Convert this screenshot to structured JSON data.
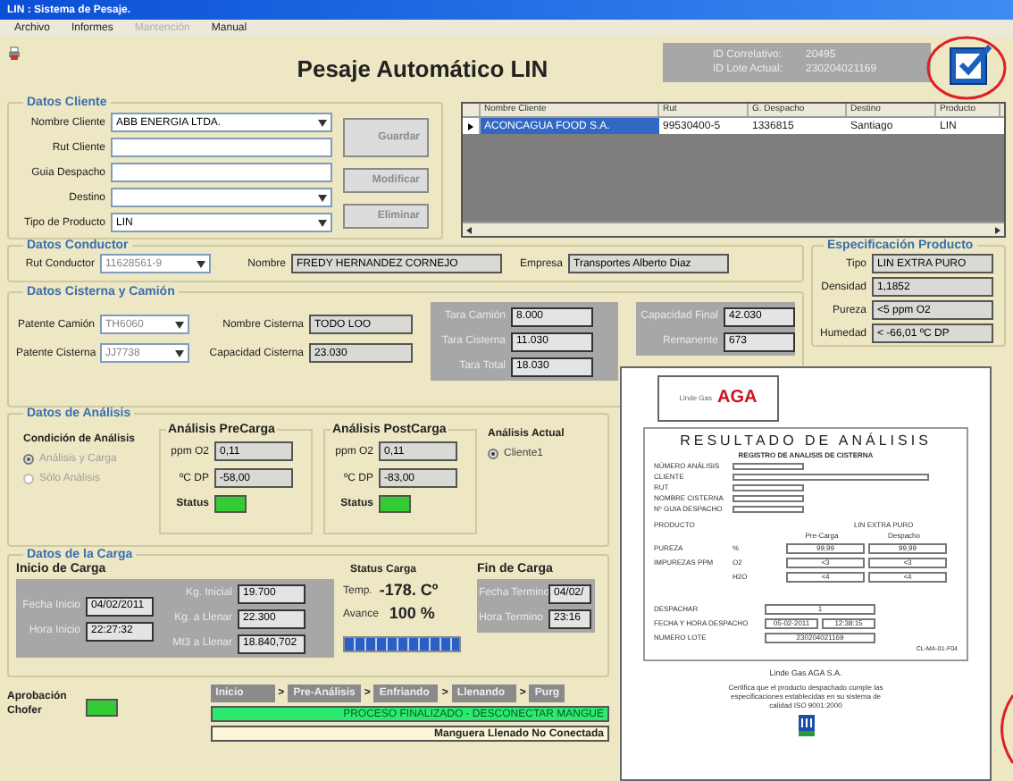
{
  "window": {
    "title": "LIN : Sistema de Pesaje."
  },
  "menu": [
    {
      "label": "Archivo",
      "disabled": false
    },
    {
      "label": "Informes",
      "disabled": false
    },
    {
      "label": "Mantención",
      "disabled": true
    },
    {
      "label": "Manual",
      "disabled": false
    }
  ],
  "header": {
    "title": "Pesaje Automático LIN",
    "ids": [
      {
        "label": "ID Correlativo:",
        "value": "20495"
      },
      {
        "label": "ID Lote Actual:",
        "value": "230204021169"
      }
    ]
  },
  "cliente": {
    "title": "Datos Cliente",
    "fields": [
      {
        "label": "Nombre Cliente",
        "value": "ABB ENERGIA LTDA.",
        "kind": "dropdown"
      },
      {
        "label": "Rut Cliente",
        "kind": "text"
      },
      {
        "label": "Guia Despacho",
        "kind": "text"
      },
      {
        "label": "Destino",
        "kind": "dropdown"
      },
      {
        "label": "Tipo de Producto",
        "value": "LIN",
        "kind": "dropdown"
      }
    ],
    "buttons": [
      "Guardar",
      "Modificar",
      "Eliminar"
    ]
  },
  "grid": {
    "columns": [
      "Nombre Cliente",
      "Rut",
      "G. Despacho",
      "Destino",
      "Producto"
    ],
    "rows": [
      {
        "cells": [
          "ACONCAGUA FOOD S.A.",
          "99530400-5",
          "1336815",
          "Santiago",
          "LIN"
        ],
        "selected": true
      }
    ]
  },
  "conductor": {
    "title": "Datos Conductor",
    "fields": [
      {
        "label": "Rut Conductor",
        "value": "11628561-9",
        "kind": "dropdown",
        "disabled": true
      },
      {
        "label": "Nombre",
        "value": "FREDY HERNANDEZ CORNEJO",
        "kind": "text",
        "disabled": false
      },
      {
        "label": "Empresa",
        "value": "Transportes Alberto Diaz",
        "kind": "text",
        "disabled": false
      }
    ]
  },
  "especificacion": {
    "title": "Especificación Producto",
    "fields": [
      {
        "label": "Tipo",
        "value": "LIN EXTRA PURO"
      },
      {
        "label": "Densidad",
        "value": "1,1852"
      },
      {
        "label": "Pureza",
        "value": "<5 ppm O2"
      },
      {
        "label": "Humedad",
        "value": "< -66,01 ºC DP"
      }
    ]
  },
  "cisterna": {
    "title": "Datos Cisterna y Camión",
    "patentes": [
      {
        "label": "Patente Camión",
        "value": "TH6060",
        "disabled": true
      },
      {
        "label": "Patente Cisterna",
        "value": "JJ7738",
        "disabled": true
      }
    ],
    "nombres": [
      {
        "label": "Nombre Cisterna",
        "value": "TODO LOO"
      },
      {
        "label": "Capacidad Cisterna",
        "value": "23.030"
      }
    ],
    "taras": [
      {
        "label": "Tara Camión",
        "value": "8.000"
      },
      {
        "label": "Tara Cisterna",
        "value": "11.030"
      },
      {
        "label": "Tara Total",
        "value": "18.030"
      }
    ],
    "capacidad": [
      {
        "label": "Capacidad Final",
        "value": "42.030"
      },
      {
        "label": "Remanente",
        "value": "673"
      }
    ]
  },
  "analisis": {
    "title": "Datos de Análisis",
    "condicion": {
      "title": "Condición de Análisis",
      "options": [
        {
          "label": "Análisis y Carga",
          "selected": true
        },
        {
          "label": "Sólo Análisis",
          "selected": false
        }
      ]
    },
    "panels": [
      {
        "title": "Análisis PreCarga",
        "fields": [
          {
            "label": "ppm O2",
            "value": "0,11"
          },
          {
            "label": "ºC DP",
            "value": "-58,00"
          }
        ],
        "status": {
          "label": "Status",
          "color": "#33cc33"
        }
      },
      {
        "title": "Análisis PostCarga",
        "fields": [
          {
            "label": "ppm O2",
            "value": "0,11"
          },
          {
            "label": "ºC DP",
            "value": "-83,00"
          }
        ],
        "status": {
          "label": "Status",
          "color": "#33cc33"
        }
      }
    ],
    "actual": {
      "title": "Análisis Actual",
      "options": [
        {
          "label": "Cliente1",
          "selected": true
        }
      ]
    }
  },
  "carga": {
    "title": "Datos de la Carga",
    "inicio": {
      "title": "Inicio de Carga",
      "left": [
        {
          "label": "Fecha Inicio",
          "value": "04/02/2011"
        },
        {
          "label": "Hora Inicio",
          "value": "22:27:32"
        }
      ],
      "right": [
        {
          "label": "Kg. Inicial",
          "value": "19.700"
        },
        {
          "label": "Kg. a Llenar",
          "value": "22.300"
        },
        {
          "label": "Mt3 a Llenar",
          "value": "18.840,702"
        }
      ]
    },
    "status": {
      "title": "Status Carga",
      "temp_label": "Temp.",
      "temp": "-178. Cº",
      "avance_label": "Avance",
      "avance": "100 %",
      "level": 1
    },
    "fin": {
      "title": "Fin de Carga",
      "fields": [
        {
          "label": "Fecha Termino",
          "value": "04/02/"
        },
        {
          "label": "Hora Termino",
          "value": "23:16"
        }
      ]
    }
  },
  "proceso": {
    "aprobacion": {
      "label": "Aprobación Chofer",
      "color": "#33cc33"
    },
    "steps": [
      {
        "label": "Inicio",
        "kind": "step"
      },
      {
        "label": ">",
        "kind": "separator"
      },
      {
        "label": "Pre-Análisis",
        "kind": "step"
      },
      {
        "label": ">",
        "kind": "separator"
      },
      {
        "label": "Enfriando",
        "kind": "step"
      },
      {
        "label": ">",
        "kind": "separator"
      },
      {
        "label": "Llenando",
        "kind": "step"
      },
      {
        "label": ">",
        "kind": "separator"
      },
      {
        "label": "Purg",
        "kind": "step"
      }
    ],
    "message": "PROCESO FINALIZADO - DESCONECTAR MANGUE",
    "hose": "Manguera Llenado No Conectada"
  },
  "document": {
    "logo": {
      "brand": "Linde Gas",
      "mark": "AGA"
    },
    "title": "RESULTADO DE ANÁLISIS",
    "subtitle": "REGISTRO DE ANALISIS DE CISTERNA",
    "fields": [
      "NÚMERO ANÁLISIS",
      "CLIENTE",
      "RUT",
      "NOMBRE CISTERNA",
      "Nº GUIA DESPACHO"
    ],
    "product": {
      "label": "PRODUCTO",
      "value": "LIN EXTRA PURO",
      "columns": [
        "Pre-Carga",
        "Despacho"
      ],
      "rows": [
        {
          "name": "PUREZA",
          "unit": "%",
          "values": [
            "99,99",
            "99,99"
          ]
        },
        {
          "name": "IMPUREZAS PPM",
          "unit": "O2",
          "values": [
            "<3",
            "<3"
          ]
        },
        {
          "unit": "H2O",
          "values": [
            "<4",
            "<4"
          ]
        }
      ]
    },
    "dispatch": [
      {
        "label": "DESPACHAR",
        "values": [
          "1"
        ]
      },
      {
        "label": "FECHA Y HORA DESPACHO",
        "values": [
          "05-02-2011",
          "12:38:15"
        ]
      },
      {
        "label": "NUMERO LOTE",
        "values": [
          "230204021169"
        ]
      }
    ],
    "code": "CL-MA-01-F04",
    "company": "Linde Gas AGA S.A.",
    "note": "Certifica que el producto despachado cumple las especificaciones establecidas en su sistema de calidad ISO 9001:2000"
  }
}
